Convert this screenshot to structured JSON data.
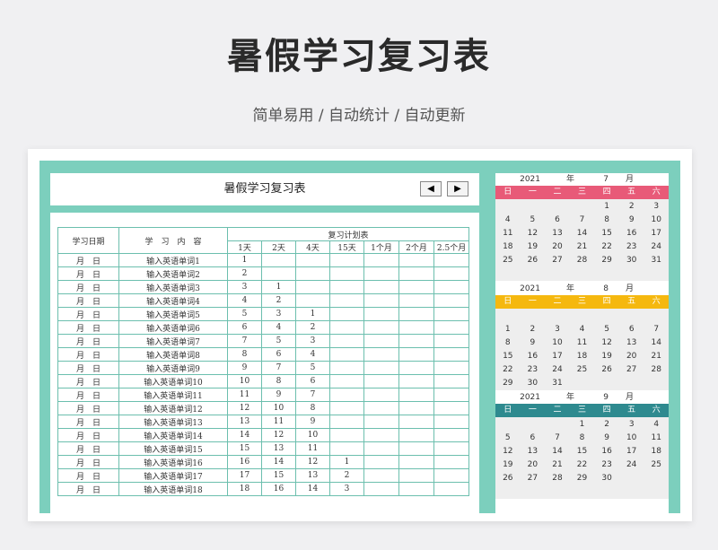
{
  "title": "暑假学习复习表",
  "subtitle": "简单易用  /  自动统计  /  自动更新",
  "sheet": {
    "header_title": "暑假学习复习表",
    "prev_label": "◀",
    "next_label": "▶",
    "col_date": "学习日期",
    "col_content": "学　习　内　容",
    "col_plan": "复习计划表",
    "plan_cols": [
      "1天",
      "2天",
      "4天",
      "15天",
      "1个月",
      "2个月",
      "2.5个月"
    ],
    "rows": [
      {
        "date": "月　日",
        "content": "输入英语单词1",
        "d1": "1",
        "d2": "",
        "d4": "",
        "d15": ""
      },
      {
        "date": "月　日",
        "content": "输入英语单词2",
        "d1": "2",
        "d2": "",
        "d4": "",
        "d15": ""
      },
      {
        "date": "月　日",
        "content": "输入英语单词3",
        "d1": "3",
        "d2": "1",
        "d4": "",
        "d15": ""
      },
      {
        "date": "月　日",
        "content": "输入英语单词4",
        "d1": "4",
        "d2": "2",
        "d4": "",
        "d15": ""
      },
      {
        "date": "月　日",
        "content": "输入英语单词5",
        "d1": "5",
        "d2": "3",
        "d4": "1",
        "d15": ""
      },
      {
        "date": "月　日",
        "content": "输入英语单词6",
        "d1": "6",
        "d2": "4",
        "d4": "2",
        "d15": ""
      },
      {
        "date": "月　日",
        "content": "输入英语单词7",
        "d1": "7",
        "d2": "5",
        "d4": "3",
        "d15": ""
      },
      {
        "date": "月　日",
        "content": "输入英语单词8",
        "d1": "8",
        "d2": "6",
        "d4": "4",
        "d15": ""
      },
      {
        "date": "月　日",
        "content": "输入英语单词9",
        "d1": "9",
        "d2": "7",
        "d4": "5",
        "d15": ""
      },
      {
        "date": "月　日",
        "content": "输入英语单词10",
        "d1": "10",
        "d2": "8",
        "d4": "6",
        "d15": ""
      },
      {
        "date": "月　日",
        "content": "输入英语单词11",
        "d1": "11",
        "d2": "9",
        "d4": "7",
        "d15": ""
      },
      {
        "date": "月　日",
        "content": "输入英语单词12",
        "d1": "12",
        "d2": "10",
        "d4": "8",
        "d15": ""
      },
      {
        "date": "月　日",
        "content": "输入英语单词13",
        "d1": "13",
        "d2": "11",
        "d4": "9",
        "d15": ""
      },
      {
        "date": "月　日",
        "content": "输入英语单词14",
        "d1": "14",
        "d2": "12",
        "d4": "10",
        "d15": ""
      },
      {
        "date": "月　日",
        "content": "输入英语单词15",
        "d1": "15",
        "d2": "13",
        "d4": "11",
        "d15": ""
      },
      {
        "date": "月　日",
        "content": "输入英语单词16",
        "d1": "16",
        "d2": "14",
        "d4": "12",
        "d15": "1"
      },
      {
        "date": "月　日",
        "content": "输入英语单词17",
        "d1": "17",
        "d2": "15",
        "d4": "13",
        "d15": "2"
      },
      {
        "date": "月　日",
        "content": "输入英语单词18",
        "d1": "18",
        "d2": "16",
        "d4": "14",
        "d15": "3"
      }
    ]
  },
  "calendar": {
    "weekdays": [
      "日",
      "一",
      "二",
      "三",
      "四",
      "五",
      "六"
    ],
    "year_label": "年",
    "month_label": "月",
    "months": [
      {
        "year": "2021",
        "month": "7",
        "color": "#e85a78",
        "weeks": [
          [
            "",
            "",
            "",
            "",
            "1",
            "2",
            "3"
          ],
          [
            "4",
            "5",
            "6",
            "7",
            "8",
            "9",
            "10"
          ],
          [
            "11",
            "12",
            "13",
            "14",
            "15",
            "16",
            "17"
          ],
          [
            "18",
            "19",
            "20",
            "21",
            "22",
            "23",
            "24"
          ],
          [
            "25",
            "26",
            "27",
            "28",
            "29",
            "30",
            "31"
          ],
          [
            "",
            "",
            "",
            "",
            "",
            "",
            ""
          ]
        ]
      },
      {
        "year": "2021",
        "month": "8",
        "color": "#f5b80f",
        "weeks": [
          [
            "",
            "",
            "",
            "",
            "",
            "",
            ""
          ],
          [
            "1",
            "2",
            "3",
            "4",
            "5",
            "6",
            "7"
          ],
          [
            "8",
            "9",
            "10",
            "11",
            "12",
            "13",
            "14"
          ],
          [
            "15",
            "16",
            "17",
            "18",
            "19",
            "20",
            "21"
          ],
          [
            "22",
            "23",
            "24",
            "25",
            "26",
            "27",
            "28"
          ],
          [
            "29",
            "30",
            "31",
            "",
            "",
            "",
            ""
          ]
        ]
      },
      {
        "year": "2021",
        "month": "9",
        "color": "#2e8a8f",
        "weeks": [
          [
            "",
            "",
            "",
            "1",
            "2",
            "3",
            "4"
          ],
          [
            "5",
            "6",
            "7",
            "8",
            "9",
            "10",
            "11"
          ],
          [
            "12",
            "13",
            "14",
            "15",
            "16",
            "17",
            "18"
          ],
          [
            "19",
            "20",
            "21",
            "22",
            "23",
            "24",
            "25"
          ],
          [
            "26",
            "27",
            "28",
            "29",
            "30",
            "",
            ""
          ],
          [
            "",
            "",
            "",
            "",
            "",
            "",
            ""
          ]
        ]
      }
    ]
  }
}
